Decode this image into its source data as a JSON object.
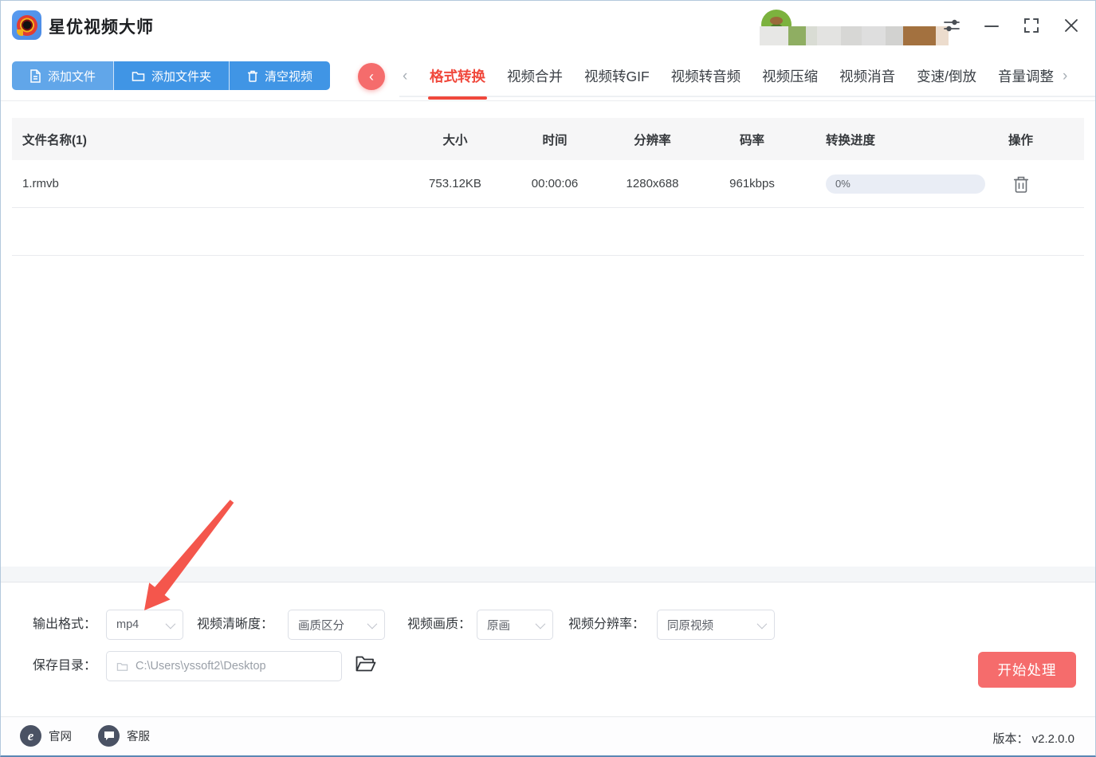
{
  "app": {
    "title": "星优视频大师"
  },
  "icons": {
    "back": "‹",
    "nav_left": "‹",
    "nav_right": "›"
  },
  "toolbar": {
    "add_file": "添加文件",
    "add_folder": "添加文件夹",
    "clear_videos": "清空视频"
  },
  "tabs": {
    "items": [
      "格式转换",
      "视频合并",
      "视频转GIF",
      "视频转音频",
      "视频压缩",
      "视频消音",
      "变速/倒放",
      "音量调整"
    ],
    "active": "格式转换"
  },
  "table": {
    "headers": {
      "name": "文件名称(1)",
      "size": "大小",
      "time": "时间",
      "resolution": "分辨率",
      "bitrate": "码率",
      "progress": "转换进度",
      "action": "操作"
    },
    "rows": [
      {
        "name": "1.rmvb",
        "size": "753.12KB",
        "time": "00:00:06",
        "resolution": "1280x688",
        "bitrate": "961kbps",
        "progress": "0%"
      }
    ]
  },
  "settings": {
    "output_format_label": "输出格式：",
    "output_format": "mp4",
    "clarity_label": "视频清晰度：",
    "clarity": "画质区分",
    "quality_label": "视频画质：",
    "quality": "原画",
    "resolution_label": "视频分辨率：",
    "resolution": "同原视频",
    "save_dir_label": "保存目录：",
    "save_dir": "C:\\Users\\yssoft2\\Desktop",
    "start_button": "开始处理"
  },
  "footer": {
    "site": "官网",
    "support": "客服",
    "version_label": "版本：",
    "version": "v2.2.0.0"
  },
  "colors": {
    "accent_blue": "#4095e5",
    "accent_red": "#f56c6c",
    "active_tab_red": "#f0483c",
    "progress_track": "#e9edf5"
  }
}
